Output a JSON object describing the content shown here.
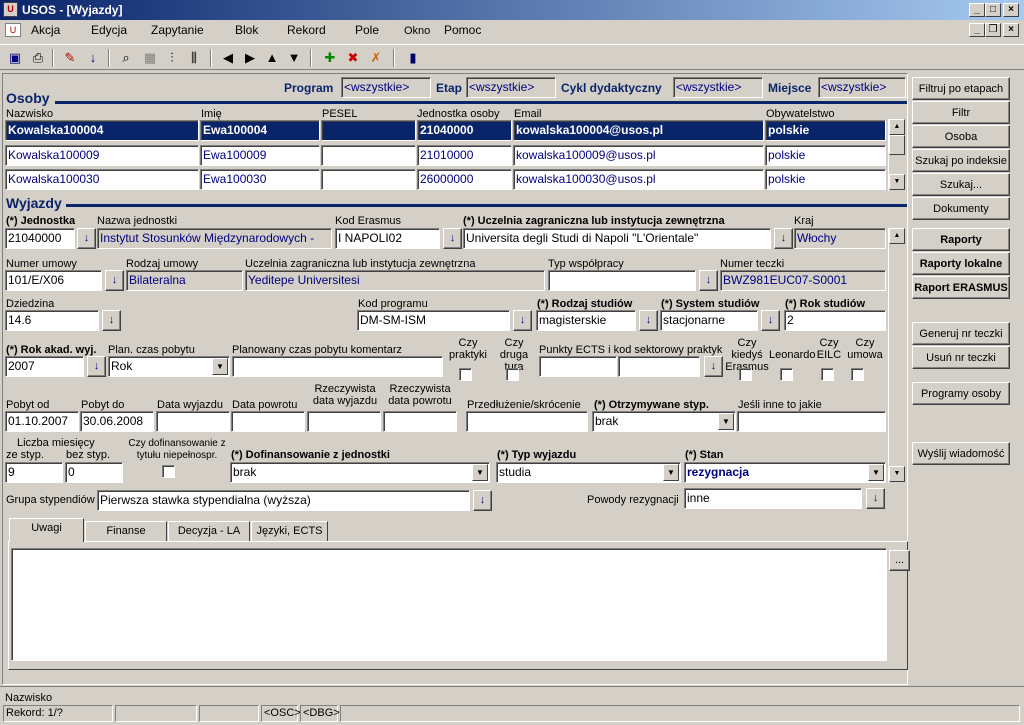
{
  "window": {
    "title": "USOS - [Wyjazdy]"
  },
  "menu": [
    "Akcja",
    "Edycja",
    "Zapytanie",
    "Blok",
    "Rekord",
    "Pole",
    "Okno",
    "Pomoc"
  ],
  "filter": {
    "program_label": "Program",
    "program_value": "<wszystkie>",
    "etap_label": "Etap",
    "etap_value": "<wszystkie>",
    "cykl_label": "Cykl dydaktyczny",
    "cykl_value": "<wszystkie>",
    "miejsce_label": "Miejsce",
    "miejsce_value": "<wszystkie>"
  },
  "osoby": {
    "title": "Osoby",
    "headers": {
      "nazwisko": "Nazwisko",
      "imie": "Imię",
      "pesel": "PESEL",
      "jednostka": "Jednostka osoby",
      "email": "Email",
      "obyw": "Obywatelstwo"
    },
    "rows": [
      {
        "nazwisko": "Kowalska100004",
        "imie": "Ewa100004",
        "pesel": "",
        "jednostka": "21040000",
        "email": "kowalska100004@usos.pl",
        "obyw": "polskie"
      },
      {
        "nazwisko": "Kowalska100009",
        "imie": "Ewa100009",
        "pesel": "",
        "jednostka": "21010000",
        "email": "kowalska100009@usos.pl",
        "obyw": "polskie"
      },
      {
        "nazwisko": "Kowalska100030",
        "imie": "Ewa100030",
        "pesel": "",
        "jednostka": "26000000",
        "email": "kowalska100030@usos.pl",
        "obyw": "polskie"
      }
    ]
  },
  "wyjazdy": {
    "title": "Wyjazdy",
    "jednostka_label": "(*) Jednostka",
    "jednostka": "21040000",
    "nazwa_jedn_label": "Nazwa jednostki",
    "nazwa_jedn": "Instytut Stosunków Międzynarodowych -",
    "kod_erasmus_label": "Kod Erasmus",
    "kod_erasmus": "I  NAPOLI02",
    "uczelnia_label": "(*) Uczelnia zagraniczna lub instytucja zewnętrzna",
    "uczelnia": "Universita degli Studi di Napoli \"L'Orientale\"",
    "kraj_label": "Kraj",
    "kraj": "Włochy",
    "numer_umowy_label": "Numer umowy",
    "numer_umowy": "101/E/X06",
    "rodzaj_umowy_label": "Rodzaj umowy",
    "rodzaj_umowy": "Bilateralna",
    "uczelnia2_label": "Uczelnia zagraniczna lub instytucja zewnętrzna",
    "uczelnia2": "Yeditepe Universitesi",
    "typ_wsp_label": "Typ współpracy",
    "typ_wsp": "",
    "numer_teczki_label": "Numer teczki",
    "numer_teczki": "BWZ981EUC07-S0001",
    "dziedzina_label": "Dziedzina",
    "dziedzina": "14.6",
    "kod_programu_label": "Kod programu",
    "kod_programu": "DM-SM-ISM",
    "rodzaj_studiow_label": "(*) Rodzaj studiów",
    "rodzaj_studiow": "magisterskie",
    "system_studiow_label": "(*) System studiów",
    "system_studiow": "stacjonarne",
    "rok_studiow_label": "(*) Rok studiów",
    "rok_studiow": "2",
    "rok_akad_label": "(*) Rok akad. wyj.",
    "rok_akad": "2007",
    "plan_czas_label": "Plan. czas pobytu",
    "plan_czas": "Rok",
    "plan_koment_label": "Planowany czas pobytu komentarz",
    "plan_koment": "",
    "czy_praktyki_label": "Czy praktyki",
    "czy_druga_label": "Czy druga tura",
    "punkty_label": "Punkty ECTS i kod sektorowy praktyk",
    "czy_erasmus_label": "Czy kiedyś Erasmus",
    "czy_leonardo_label": "Leonardo",
    "czy_eilc_label": "Czy EILC",
    "czy_umowa_label": "Czy umowa",
    "pobyt_od_label": "Pobyt od",
    "pobyt_od": "01.10.2007",
    "pobyt_do_label": "Pobyt do",
    "pobyt_do": "30.06.2008",
    "data_wyj_label": "Data wyjazdu",
    "data_pow_label": "Data powrotu",
    "rz_data_wyj_label": "Rzeczywista data wyjazdu",
    "rz_data_pow_label": "Rzeczywista data powrotu",
    "przedl_label": "Przedłużenie/skrócenie",
    "otrzym_label": "(*) Otrzymywane styp.",
    "otrzym": "brak",
    "inne_label": "Jeśli inne to jakie",
    "liczba_label": "Liczba miesięcy",
    "ze_styp_label": "ze styp.",
    "bez_styp_label": "bez styp.",
    "ze_styp": "9",
    "bez_styp": "0",
    "czy_dofin_label": "Czy dofinansowanie z tytułu niepełnospr.",
    "dofin_label": "(*) Dofinansowanie z jednostki",
    "dofin": "brak",
    "typ_wyj_label": "(*) Typ wyjazdu",
    "typ_wyj": "studia",
    "stan_label": "(*) Stan",
    "stan": "rezygnacja",
    "grupa_label": "Grupa stypendiów",
    "grupa": "Pierwsza stawka stypendialna (wyższa)",
    "powody_label": "Powody rezygnacji",
    "powody": "inne"
  },
  "tabs": [
    "Uwagi",
    "Finanse",
    "Decyzja - LA",
    "Języki, ECTS"
  ],
  "side_buttons": {
    "filtruj": "Filtruj po etapach",
    "filtr": "Filtr",
    "osoba": "Osoba",
    "szukaj_indeks": "Szukaj po indeksie",
    "szukaj": "Szukaj...",
    "dokumenty": "Dokumenty",
    "raporty": "Raporty",
    "raporty_lok": "Raporty lokalne",
    "raport_erasmus": "Raport ERASMUS",
    "generuj": "Generuj nr teczki",
    "usun": "Usuń nr teczki",
    "programy": "Programy osoby",
    "wyslij": "Wyślij wiadomość"
  },
  "notes_button": "...",
  "status": {
    "hint": "Nazwisko",
    "record": "Rekord: 1/?",
    "osc": "<OSC>",
    "dbg": "<DBG>"
  }
}
